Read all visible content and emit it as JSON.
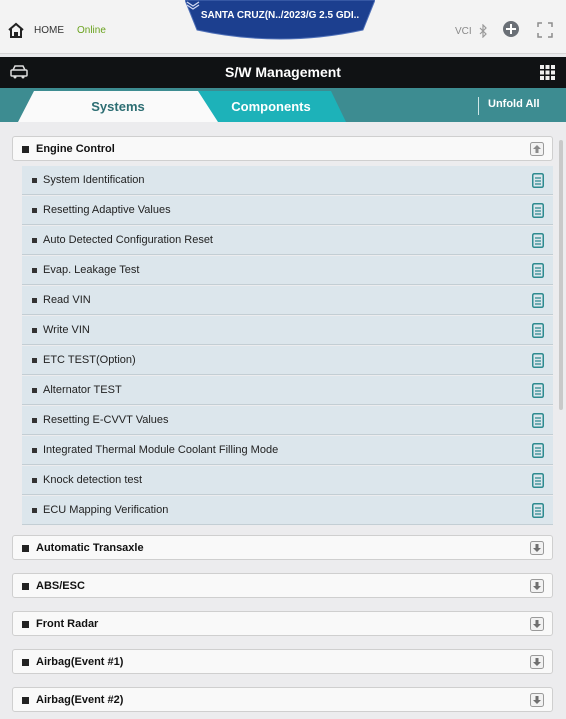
{
  "status_bar": {
    "home_label": "HOME",
    "online_label": "Online",
    "vehicle": "SANTA CRUZ(N../2023/G 2.5 GDI..",
    "vci_label": "VCI"
  },
  "title_bar": {
    "title": "S/W Management"
  },
  "tabs": [
    {
      "label": "Systems",
      "active": true
    },
    {
      "label": "Components",
      "active": false
    }
  ],
  "unfold_all": "Unfold All",
  "groups": [
    {
      "label": "Engine Control",
      "expanded": true,
      "items": [
        "System Identification",
        "Resetting Adaptive Values",
        "Auto Detected Configuration Reset",
        "Evap. Leakage Test",
        "Read VIN",
        "Write VIN",
        "ETC TEST(Option)",
        "Alternator TEST",
        "Resetting E-CVVT Values",
        "Integrated Thermal Module Coolant Filling Mode",
        "Knock detection test",
        "ECU Mapping Verification"
      ]
    },
    {
      "label": "Automatic Transaxle",
      "expanded": false
    },
    {
      "label": "ABS/ESC",
      "expanded": false
    },
    {
      "label": "Front Radar",
      "expanded": false
    },
    {
      "label": "Airbag(Event #1)",
      "expanded": false
    },
    {
      "label": "Airbag(Event #2)",
      "expanded": false
    }
  ],
  "colors": {
    "title_bar": "#101214",
    "tab_row": "#3d8c91",
    "tab_active_text": "#2d6e73",
    "tab_components": "#1db2b9",
    "online": "#6aa21e",
    "banner": "#1c3f8f",
    "sub_item_bg": "#dce6ec",
    "doc_icon": "#2d8a8f"
  }
}
